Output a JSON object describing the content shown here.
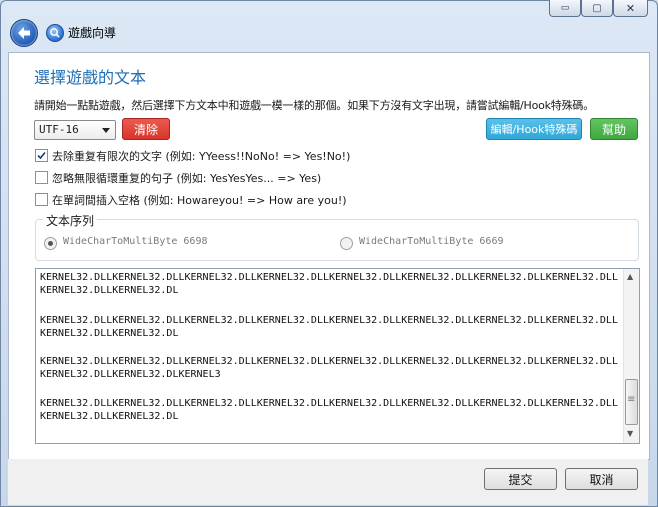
{
  "window": {
    "title": "遊戲向導",
    "minimize_glyph": "▭",
    "maximize_glyph": "▢",
    "close_glyph": "✕"
  },
  "page": {
    "heading": "選擇遊戲的文本",
    "instruction": "請開始一點點遊戲，然后選擇下方文本中和遊戲一模一樣的那個。如果下方沒有文字出現，請嘗試編輯/Hook特殊碼。"
  },
  "toolbar": {
    "encoding_value": "UTF-16",
    "clear_label": "清除",
    "edit_hook_label": "編輯/Hook特殊碼",
    "help_label": "幫助"
  },
  "options": [
    {
      "label": "去除重复有限次的文字 (例如: YYeess!!NoNo! => Yes!No!)",
      "checked": true
    },
    {
      "label": "忽略無限循環重复的句子 (例如: YesYesYes... => Yes)",
      "checked": false
    },
    {
      "label": "在單詞間插入空格 (例如: Howareyou! => How are you!)",
      "checked": false
    }
  ],
  "sequence": {
    "legend": "文本序列",
    "items": [
      {
        "label": "WideCharToMultiByte 6698",
        "selected": true
      },
      {
        "label": "WideCharToMultiByte 6669",
        "selected": false
      }
    ]
  },
  "text_blocks": [
    [
      "KERNEL32.DLLKERNEL32.DLLKERNEL32.DLLKERNEL32.DLLKERNEL32.DLLKERNEL32.DLLKERNEL32.DLLKERNEL32.DLL",
      "KERNEL32.DLLKERNEL32.DL"
    ],
    [
      "KERNEL32.DLLKERNEL32.DLLKERNEL32.DLLKERNEL32.DLLKERNEL32.DLLKERNEL32.DLLKERNEL32.DLLKERNEL32.DLL",
      "KERNEL32.DLLKERNEL32.DL"
    ],
    [
      "KERNEL32.DLLKERNEL32.DLLKERNEL32.DLLKERNEL32.DLLKERNEL32.DLLKERNEL32.DLLKERNEL32.DLLKERNEL32.DLL",
      "KERNEL32.DLLKERNEL32.DLKERNEL3"
    ],
    [
      "KERNEL32.DLLKERNEL32.DLLKERNEL32.DLLKERNEL32.DLLKERNEL32.DLLKERNEL32.DLLKERNEL32.DLLKERNEL32.DLL",
      "KERNEL32.DLLKERNEL32.DL"
    ]
  ],
  "scrollbar": {
    "up_glyph": "▲",
    "down_glyph": "▼",
    "grip_glyph": "≡"
  },
  "footer": {
    "submit_label": "提交",
    "cancel_label": "取消"
  },
  "colors": {
    "accent_blue": "#1b6fb7",
    "clear_red": "#d9342b",
    "edit_teal": "#2fa7d8",
    "help_green": "#3ea83e"
  }
}
